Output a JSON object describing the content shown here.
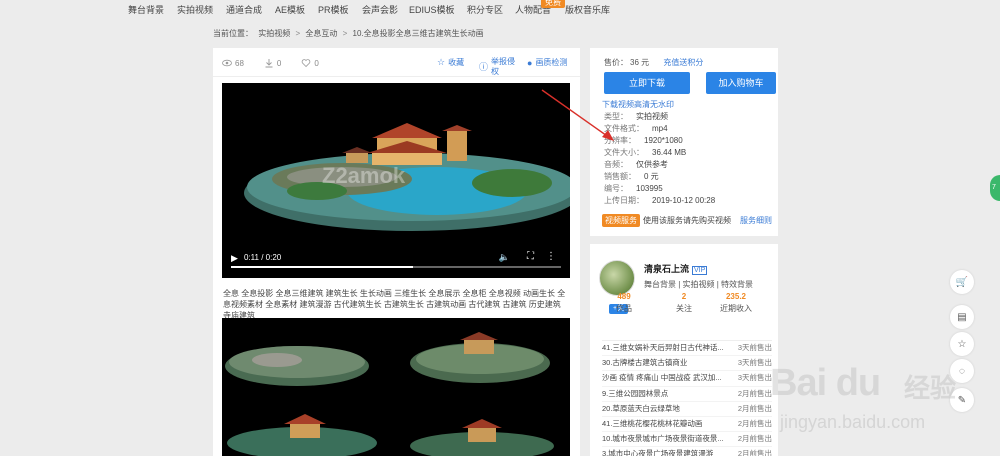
{
  "topnav": {
    "items": [
      "舞台背景",
      "实拍视频",
      "通道合成",
      "AE模板",
      "PR模板",
      "会声会影",
      "EDIUS模板",
      "积分专区",
      "人物配音",
      "版权音乐库"
    ],
    "new_badge": "免费"
  },
  "breadcrumb": {
    "prefix": "当前位置：",
    "parts": [
      "实拍视频",
      "全息互动",
      "10.全息投影全息三维古建筑生长动画"
    ],
    "sep": ">"
  },
  "stats": {
    "views": "68",
    "downloads": "0",
    "likes": "0"
  },
  "actions": {
    "favorite": "收藏",
    "report": "举报侵权",
    "detect": "画质检测"
  },
  "video": {
    "time": "0:11 / 0:20",
    "progress": 0.55,
    "watermark": "Z2amok"
  },
  "tags": "全息 全息投影 全息三维建筑 建筑生长 生长动画 三维生长 全息展示 全息柜 全息视频 动画生长 全息视频素材 全息素材 建筑漫游 古代建筑生长 古建筑生长 古建筑动画 古代建筑 古建筑 历史建筑 寺庙建筑",
  "purchase": {
    "price_label": "售价：",
    "price_value": "36 元",
    "recharge_link": "充值送积分",
    "download_btn": "立即下载",
    "cart_btn": "加入购物车",
    "hint_link": "下载视频高清无水印"
  },
  "info": [
    {
      "k": "类型：",
      "v": "实拍视频"
    },
    {
      "k": "文件格式：",
      "v": "mp4"
    },
    {
      "k": "分辨率：",
      "v": "1920*1080"
    },
    {
      "k": "文件大小：",
      "v": "36.44 MB"
    },
    {
      "k": "音频：",
      "v": "仅供参考"
    },
    {
      "k": "销售额：",
      "v": "0 元"
    },
    {
      "k": "编号：",
      "v": "103995"
    },
    {
      "k": "上传日期：",
      "v": "2019-10-12 00:28"
    }
  ],
  "service": {
    "tag": "视频服务",
    "text": "使用该服务请先购买视频",
    "link": "服务细则"
  },
  "author": {
    "name": "清泉石上流",
    "vip": "VIP",
    "follow": "+关",
    "cats": "舞台背景 | 实拍视频 | 特效背景",
    "works_num": "489",
    "works_label": "作品",
    "follow_num": "2",
    "follow_label": "关注",
    "income_num": "235.2",
    "income_label": "近期收入"
  },
  "sales": [
    {
      "t": "41.三维女娲补天后羿射日古代神话...",
      "d": "3天前售出"
    },
    {
      "t": "30.古牌楼古建筑古镇商业",
      "d": "3天前售出"
    },
    {
      "t": "沙画 疫情 疼痛山 中国战疫 武汉加...",
      "d": "3天前售出"
    },
    {
      "t": "9.三维公园园林景点",
      "d": "2月前售出"
    },
    {
      "t": "20.草原蓝天白云绿草地",
      "d": "2月前售出"
    },
    {
      "t": "41.三维桃花樱花桃林花瓣动画",
      "d": "2月前售出"
    },
    {
      "t": "10.城市夜景城市广场夜景街道夜景...",
      "d": "2月前售出"
    },
    {
      "t": "3.城市中心夜景广场夜景建筑漫游",
      "d": "2月前售出"
    }
  ],
  "float_label": "7",
  "watermark": {
    "logo": "Bai du",
    "cn": "经验",
    "url": "jingyan.baidu.com"
  },
  "colors": {
    "accent": "#2b84e6",
    "orange": "#f08a24",
    "green": "#3bb86b"
  },
  "icons": [
    "eye-icon",
    "download-icon",
    "heart-icon",
    "star-icon",
    "report-icon",
    "dot-icon",
    "play-icon",
    "volume-icon",
    "fullscreen-icon",
    "more-icon",
    "cart-icon",
    "note-icon",
    "star-outline-icon",
    "bell-icon",
    "edit-icon"
  ]
}
